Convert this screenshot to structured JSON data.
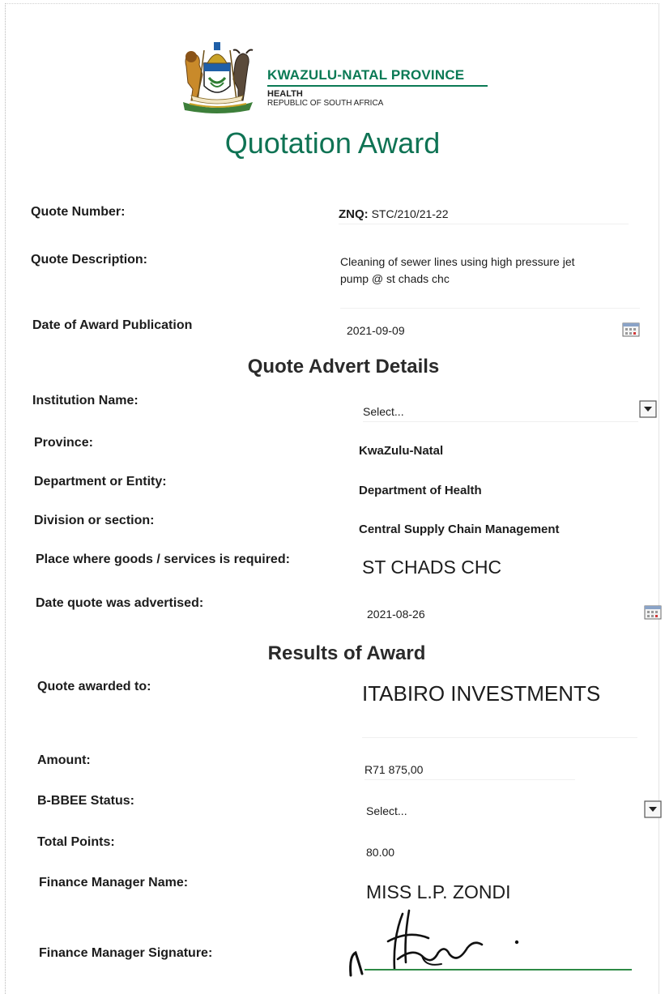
{
  "header": {
    "province": "KWAZULU-NATAL PROVINCE",
    "department": "HEALTH",
    "country": "REPUBLIC OF SOUTH AFRICA",
    "brand_color": "#0b7a55"
  },
  "title": "Quotation Award",
  "quote": {
    "number_label": "Quote Number:",
    "number_prefix": "ZNQ:",
    "number_value": "STC/210/21-22",
    "description_label": "Quote Description:",
    "description_line1": "Cleaning of sewer lines using high pressure jet",
    "description_line2": "pump @ st chads chc",
    "publication_label": "Date of Award Publication",
    "publication_date": "2021-09-09"
  },
  "advert": {
    "heading": "Quote Advert Details",
    "institution_label": "Institution Name:",
    "institution_value": "Select...",
    "province_label": "Province:",
    "province_value": "KwaZulu-Natal",
    "department_label": "Department or Entity:",
    "department_value": "Department of Health",
    "division_label": "Division or section:",
    "division_value": "Central Supply Chain Management",
    "place_label": "Place where goods /  services is required:",
    "place_value": "ST CHADS CHC",
    "advertised_label": "Date quote was advertised:",
    "advertised_date": "2021-08-26"
  },
  "results": {
    "heading": "Results of Award",
    "awarded_label": "Quote awarded to:",
    "awarded_value": "ITABIRO INVESTMENTS",
    "amount_label": "Amount:",
    "amount_value": "R71 875,00",
    "bbbee_label": "B-BBEE Status:",
    "bbbee_value": "Select...",
    "points_label": "Total Points:",
    "points_value": "80.00",
    "manager_label": "Finance Manager Name:",
    "manager_value": "MISS L.P. ZONDI",
    "signature_label": "Finance Manager Signature:"
  },
  "icons": {
    "calendar": "calendar-icon",
    "dropdown": "chevron-down-icon",
    "coat_of_arms": "coat-of-arms-emblem",
    "signature": "handwritten-signature"
  }
}
